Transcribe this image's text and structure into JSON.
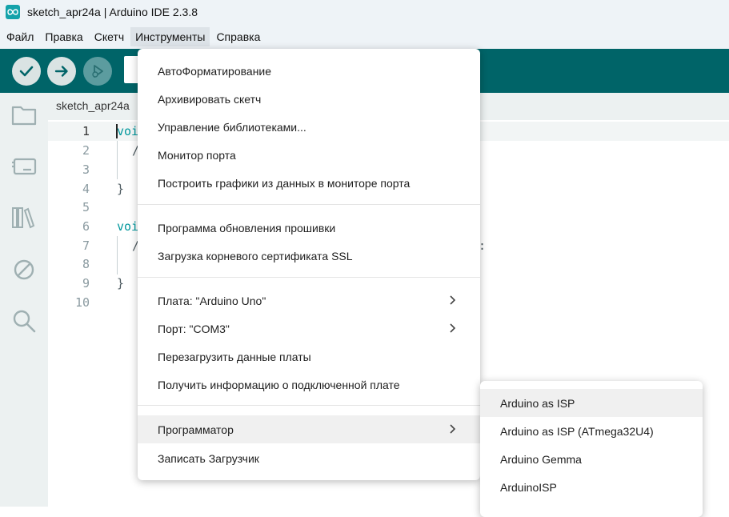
{
  "window": {
    "title": "sketch_apr24a | Arduino IDE 2.3.8",
    "app_icon": "arduino-logo-icon"
  },
  "menubar": {
    "items": [
      {
        "label": "Файл"
      },
      {
        "label": "Правка"
      },
      {
        "label": "Скетч"
      },
      {
        "label": "Инструменты",
        "active": true
      },
      {
        "label": "Справка"
      }
    ]
  },
  "toolbar": {
    "buttons": [
      {
        "name": "verify",
        "icon": "checkmark-icon"
      },
      {
        "name": "upload",
        "icon": "arrow-right-icon"
      },
      {
        "name": "debug",
        "icon": "debug-icon"
      }
    ],
    "accent": "#006468"
  },
  "sidebar": {
    "icons": [
      "folder-icon",
      "board-icon",
      "library-icon",
      "debug-disabled-icon",
      "search-icon"
    ]
  },
  "editor": {
    "tab": "sketch_apr24a",
    "line_numbers": [
      "1",
      "2",
      "3",
      "4",
      "5",
      "6",
      "7",
      "8",
      "9",
      "10"
    ],
    "current_line": "1",
    "code": {
      "l1": "voi",
      "l2": "/",
      "l4": "}",
      "l6": "voi",
      "l7": "/",
      "l7_tail": ":",
      "l9": "}"
    }
  },
  "tools_menu": {
    "items": {
      "autoformat": "АвтоФорматирование",
      "archive": "Архивировать скетч",
      "libraries": "Управление библиотеками...",
      "serial_monitor": "Монитор порта",
      "serial_plotter": "Построить графики из данных в мониторе порта",
      "firmware_updater": "Программа обновления прошивки",
      "ssl_cert": "Загрузка корневого сертификата SSL",
      "board": "Плата: \"Arduino Uno\"",
      "port": "Порт: \"COM3\"",
      "reload_board": "Перезагрузить данные платы",
      "board_info": "Получить информацию о подключенной плате",
      "programmer": "Программатор",
      "burn_bootloader": "Записать Загрузчик"
    },
    "highlighted": "programmer"
  },
  "programmer_submenu": {
    "items": [
      "Arduino as ISP",
      "Arduino as ISP (ATmega32U4)",
      "Arduino Gemma",
      "ArduinoISP"
    ],
    "highlighted": "Arduino as ISP"
  }
}
